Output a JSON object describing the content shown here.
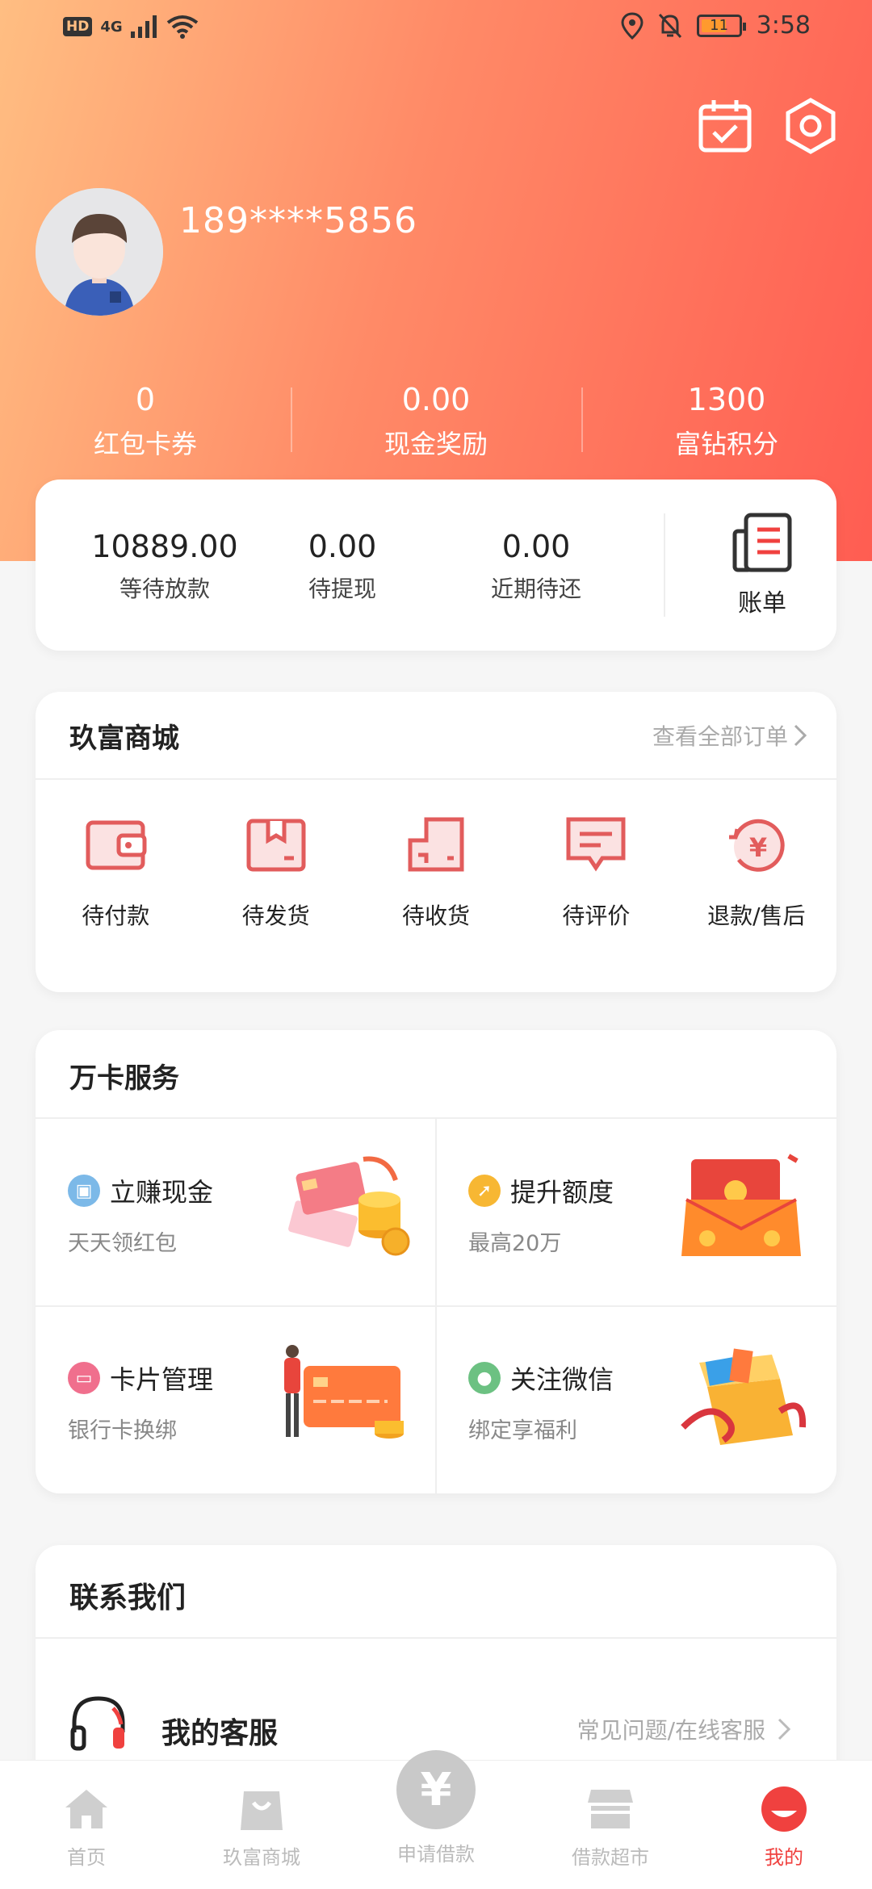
{
  "status_bar": {
    "hd": "HD",
    "network": "4G",
    "battery": "11",
    "time": "3:58"
  },
  "profile": {
    "phone": "189****5856"
  },
  "stats": [
    {
      "value": "0",
      "label": "红包卡券"
    },
    {
      "value": "0.00",
      "label": "现金奖励"
    },
    {
      "value": "1300",
      "label": "富钻积分"
    }
  ],
  "loan": {
    "items": [
      {
        "value": "10889.00",
        "label": "等待放款"
      },
      {
        "value": "0.00",
        "label": "待提现"
      },
      {
        "value": "0.00",
        "label": "近期待还"
      }
    ],
    "bill_label": "账单"
  },
  "mall": {
    "title": "玖富商城",
    "view_all": "查看全部订单",
    "orders": [
      {
        "label": "待付款",
        "icon": "wallet-icon"
      },
      {
        "label": "待发货",
        "icon": "box-icon"
      },
      {
        "label": "待收货",
        "icon": "receive-icon"
      },
      {
        "label": "待评价",
        "icon": "comment-icon"
      },
      {
        "label": "退款/售后",
        "icon": "refund-icon"
      }
    ]
  },
  "services": {
    "title": "万卡服务",
    "items": [
      {
        "title": "立赚现金",
        "subtitle": "天天领红包",
        "icon": "gift-icon",
        "color": "#7cb9e8"
      },
      {
        "title": "提升额度",
        "subtitle": "最高20万",
        "icon": "arrow-up-icon",
        "color": "#f7b733"
      },
      {
        "title": "卡片管理",
        "subtitle": "银行卡换绑",
        "icon": "card-icon",
        "color": "#f06f8d"
      },
      {
        "title": "关注微信",
        "subtitle": "绑定享福利",
        "icon": "wechat-icon",
        "color": "#6cc182"
      }
    ]
  },
  "contact": {
    "title": "联系我们",
    "service_title": "我的客服",
    "service_link": "常见问题/在线客服"
  },
  "tabbar": {
    "items": [
      {
        "label": "首页",
        "icon": "home-icon"
      },
      {
        "label": "玖富商城",
        "icon": "shopping-bag-icon"
      },
      {
        "label": "申请借款",
        "icon": "yuan-icon",
        "glyph": "¥"
      },
      {
        "label": "借款超市",
        "icon": "store-icon"
      },
      {
        "label": "我的",
        "icon": "profile-icon"
      }
    ],
    "active_color": "#f0413f"
  }
}
